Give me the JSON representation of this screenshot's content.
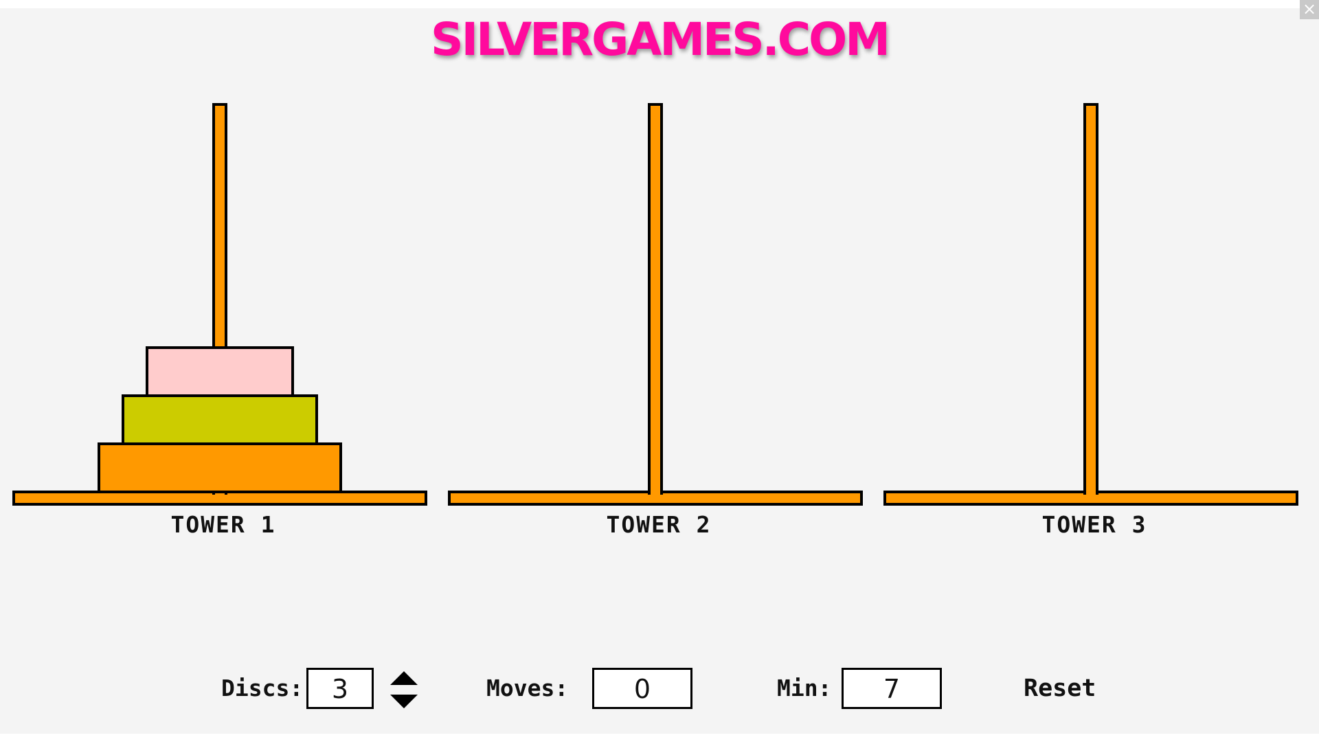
{
  "logo": {
    "text": "SILVERGAMES.COM",
    "color": "#ff0a9d"
  },
  "close": {
    "icon": "close-icon",
    "glyph": "×"
  },
  "colors": {
    "peg": "#ff9900",
    "outline": "#000000",
    "background": "#f4f4f4",
    "disc_1": "#ffcccc",
    "disc_2": "#cccc00",
    "disc_3": "#ff9900"
  },
  "towers": [
    {
      "label": "TOWER 1",
      "discs": [
        3,
        2,
        1
      ]
    },
    {
      "label": "TOWER 2",
      "discs": []
    },
    {
      "label": "TOWER 3",
      "discs": []
    }
  ],
  "controls": {
    "discs_label": "Discs:",
    "discs_value": "3",
    "increase_icon": "triangle-up-icon",
    "decrease_icon": "triangle-down-icon",
    "moves_label": "Moves:",
    "moves_value": "0",
    "min_label": "Min:",
    "min_value": "7",
    "reset_label": "Reset"
  }
}
